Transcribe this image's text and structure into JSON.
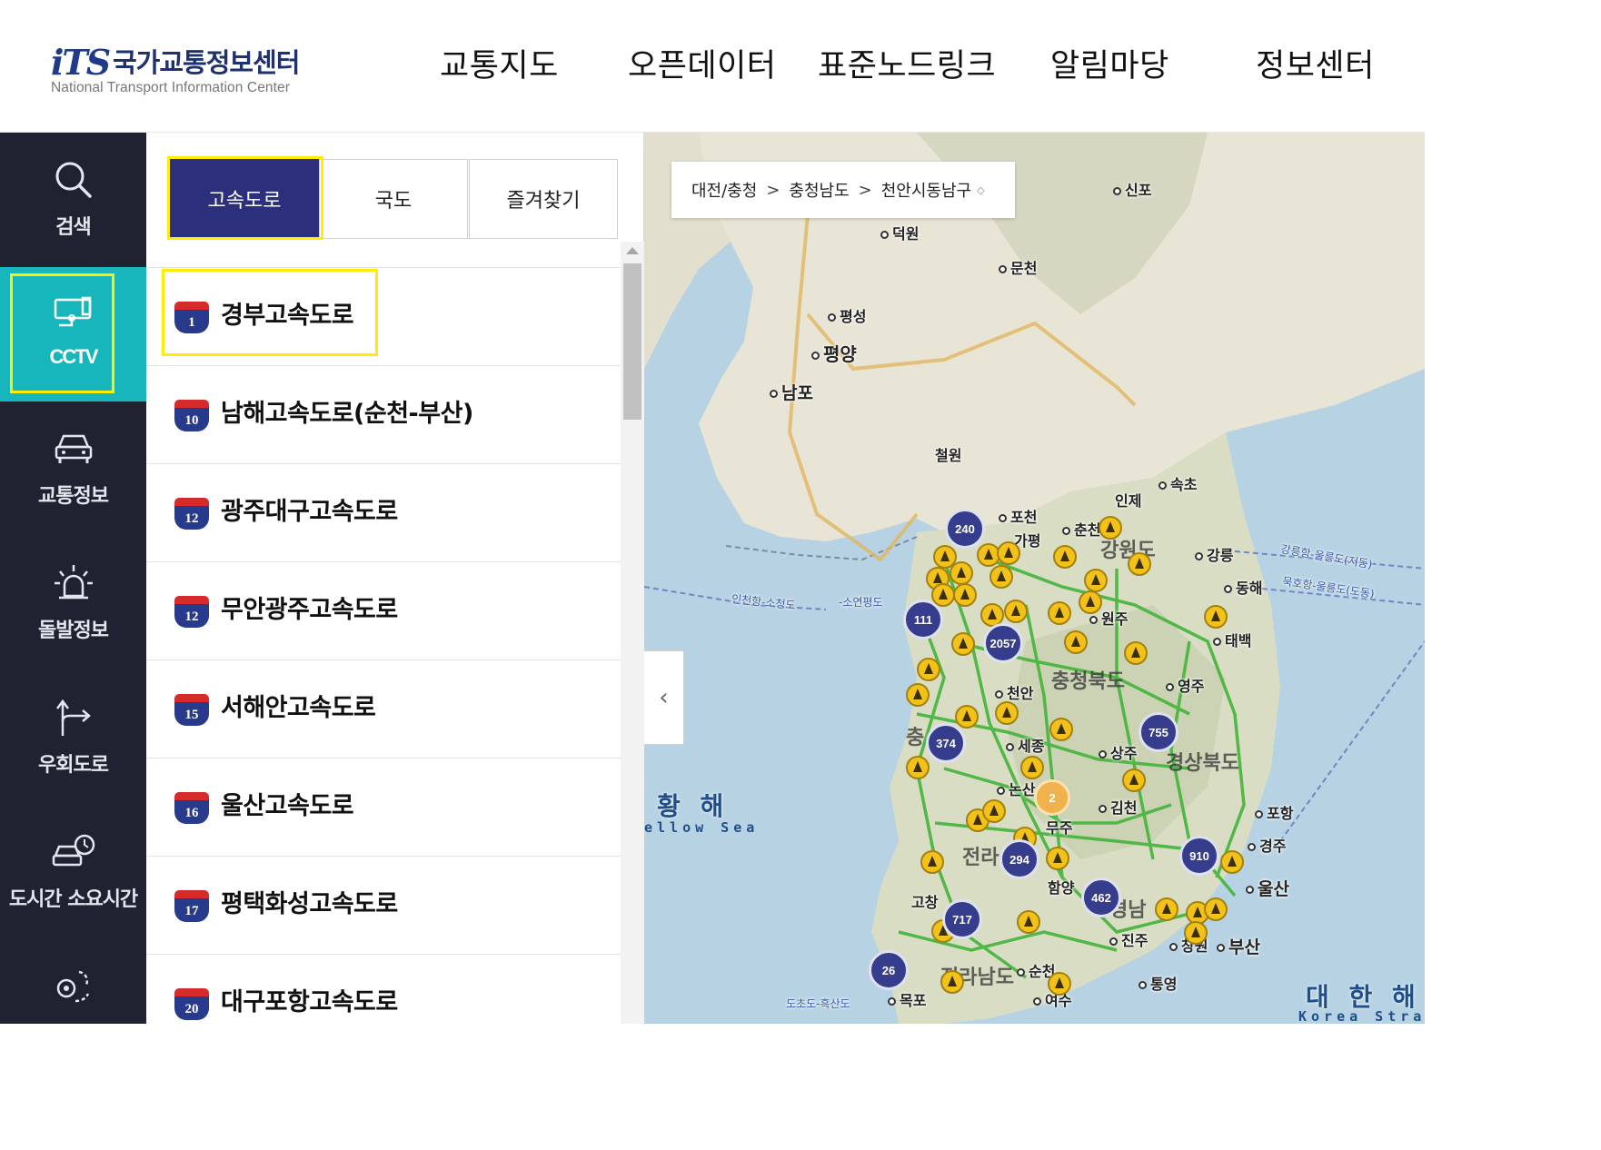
{
  "header": {
    "logo_mark": "iTS",
    "logo_title": "국가교통정보센터",
    "logo_subtitle": "National Transport Information Center",
    "menu": [
      "교통지도",
      "오픈데이터",
      "표준노드링크",
      "알림마당",
      "정보센터"
    ]
  },
  "sidebar": {
    "items": [
      {
        "label": "검색",
        "icon": "search-icon"
      },
      {
        "label": "CCTV",
        "icon": "cctv-icon",
        "active": true
      },
      {
        "label": "교통정보",
        "icon": "car-icon"
      },
      {
        "label": "돌발정보",
        "icon": "alert-siren-icon"
      },
      {
        "label": "우회도로",
        "icon": "detour-arrow-icon"
      },
      {
        "label": "도시간 소요시간",
        "icon": "car-clock-icon"
      },
      {
        "label": "",
        "icon": "location-pin-icon"
      }
    ]
  },
  "panel": {
    "tabs": [
      "고속도로",
      "국도",
      "즐겨찾기"
    ],
    "active_tab": "고속도로",
    "roads": [
      {
        "number": "1",
        "name": "경부고속도로"
      },
      {
        "number": "10",
        "name": "남해고속도로(순천-부산)"
      },
      {
        "number": "12",
        "name": "광주대구고속도로"
      },
      {
        "number": "12",
        "name": "무안광주고속도로"
      },
      {
        "number": "15",
        "name": "서해안고속도로"
      },
      {
        "number": "16",
        "name": "울산고속도로"
      },
      {
        "number": "17",
        "name": "평택화성고속도로"
      },
      {
        "number": "20",
        "name": "대구포항고속도로"
      }
    ]
  },
  "map": {
    "breadcrumb": [
      "대전/충청",
      "충청남도",
      "천안시동남구"
    ],
    "breadcrumb_sep": ">",
    "breadcrumb_caret": "◇",
    "collapse_label": "‹",
    "places": [
      "신포",
      "덕원",
      "문천",
      "평성",
      "평양",
      "남포",
      "철원",
      "속초",
      "인제",
      "포천",
      "가평",
      "춘천",
      "강릉",
      "동해",
      "원주",
      "태백",
      "영주",
      "천안",
      "세종",
      "논산",
      "상주",
      "김천",
      "무주",
      "경주",
      "포항",
      "울산",
      "고창",
      "함양",
      "진주",
      "창원",
      "부산",
      "순천",
      "통영",
      "목포",
      "여수"
    ],
    "regions": [
      "강원도",
      "충청북도",
      "경상북도",
      "충",
      "전라",
      "경남",
      "전라남도"
    ],
    "sea": {
      "name": "황 해",
      "sub": "ellow Sea",
      "east": "대 한 해 협",
      "east_sub": "Korea Strait"
    },
    "clusters": [
      "240",
      "111",
      "2057",
      "374",
      "755",
      "294",
      "910",
      "462",
      "717",
      "26",
      "2"
    ],
    "ferry_routes": [
      "강릉항-울릉도(저동)",
      "묵호항-울릉도(도동)",
      "인천항-소청도",
      "-소연평도",
      "도초도-흑산도"
    ],
    "colors": {
      "active_tab": "#2b2f7c",
      "active_nav": "#17b6bc",
      "highlight": "#ffee00",
      "nav_bg": "#1f2230",
      "cluster": "#353d8c",
      "incident": "#f2c21a"
    }
  }
}
